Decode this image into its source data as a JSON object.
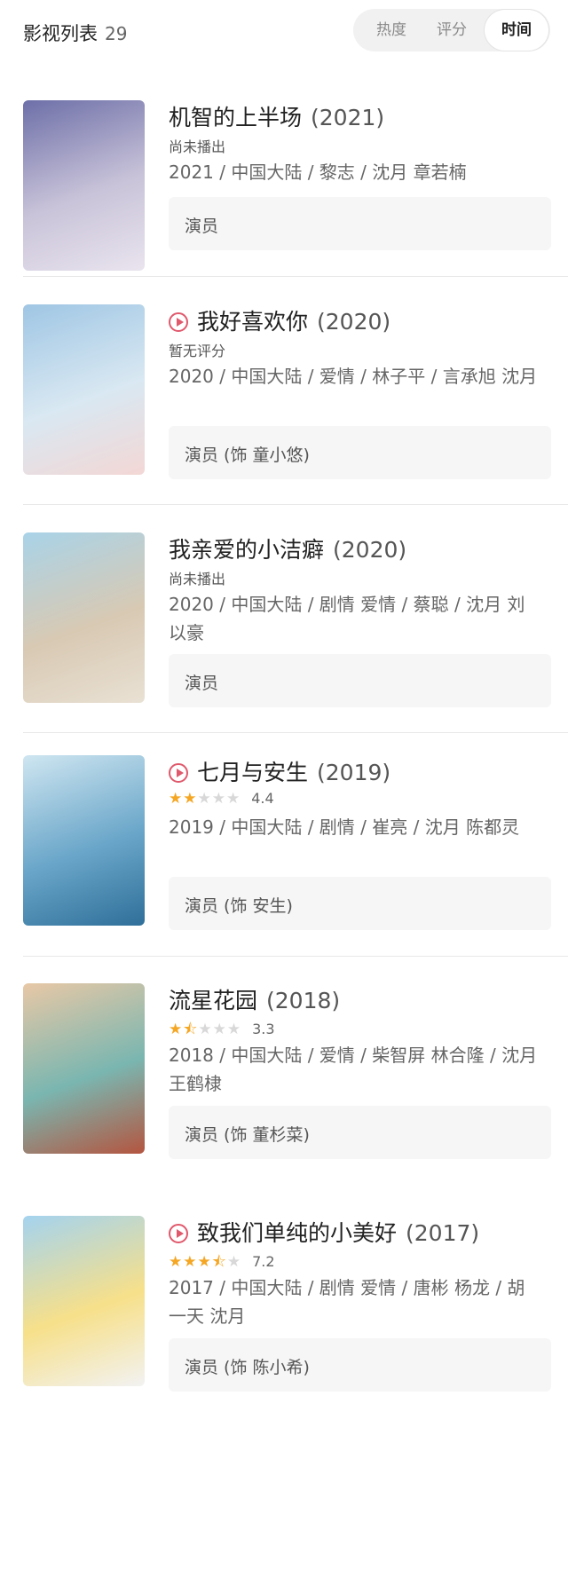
{
  "header": {
    "title": "影视列表",
    "count": "29",
    "sort_options": [
      "热度",
      "评分",
      "时间"
    ],
    "active_sort": "时间"
  },
  "accent": "#e0596c",
  "star_color": "#f5a623",
  "items": [
    {
      "title": "机智的上半场",
      "year": "(2021)",
      "has_play": false,
      "status": "尚未播出",
      "meta": "2021 / 中国大陆 / 黎志 / 沈月 章若楠",
      "role": "演员",
      "poster_colors": [
        "#6d6fa8",
        "#c9c3d9",
        "#e9e4ee"
      ]
    },
    {
      "title": "我好喜欢你",
      "year": "(2020)",
      "has_play": true,
      "status": "暂无评分",
      "meta": "2020 / 中国大陆 / 爱情 / 林子平 / 言承旭 沈月",
      "role": "演员 (饰 童小悠)",
      "poster_colors": [
        "#9fc6e4",
        "#d9e8f2",
        "#f3d7d5"
      ]
    },
    {
      "title": "我亲爱的小洁癖",
      "year": "(2020)",
      "has_play": false,
      "status": "尚未播出",
      "meta": "2020 / 中国大陆 / 剧情 爱情 / 蔡聪 / 沈月 刘以豪",
      "role": "演员",
      "poster_colors": [
        "#a9d3e8",
        "#d8c9b3",
        "#e9e1d4"
      ]
    },
    {
      "title": "七月与安生",
      "year": "(2019)",
      "has_play": true,
      "rating": {
        "value": 4.4,
        "text": "4.4",
        "stars": 2
      },
      "meta": "2019 / 中国大陆 / 剧情 / 崔亮 / 沈月 陈都灵",
      "role": "演员 (饰 安生)",
      "poster_colors": [
        "#cfe6f1",
        "#6aa6c9",
        "#2f6f99"
      ]
    },
    {
      "title": "流星花园",
      "year": "(2018)",
      "has_play": false,
      "rating": {
        "value": 3.3,
        "text": "3.3",
        "stars": 1.5
      },
      "meta": "2018 / 中国大陆 / 爱情 / 柴智屏 林合隆 / 沈月 王鹤棣",
      "role": "演员 (饰 董杉菜)",
      "poster_colors": [
        "#e8c8a6",
        "#7ab6b0",
        "#b4553f"
      ]
    },
    {
      "title": "致我们单纯的小美好",
      "year": "(2017)",
      "has_play": true,
      "rating": {
        "value": 7.2,
        "text": "7.2",
        "stars": 3.5
      },
      "meta": "2017 / 中国大陆 / 剧情 爱情 / 唐彬 杨龙 / 胡一天 沈月",
      "role": "演员 (饰 陈小希)",
      "poster_colors": [
        "#a4d3ef",
        "#f7e08a",
        "#f2f2f2"
      ]
    }
  ]
}
